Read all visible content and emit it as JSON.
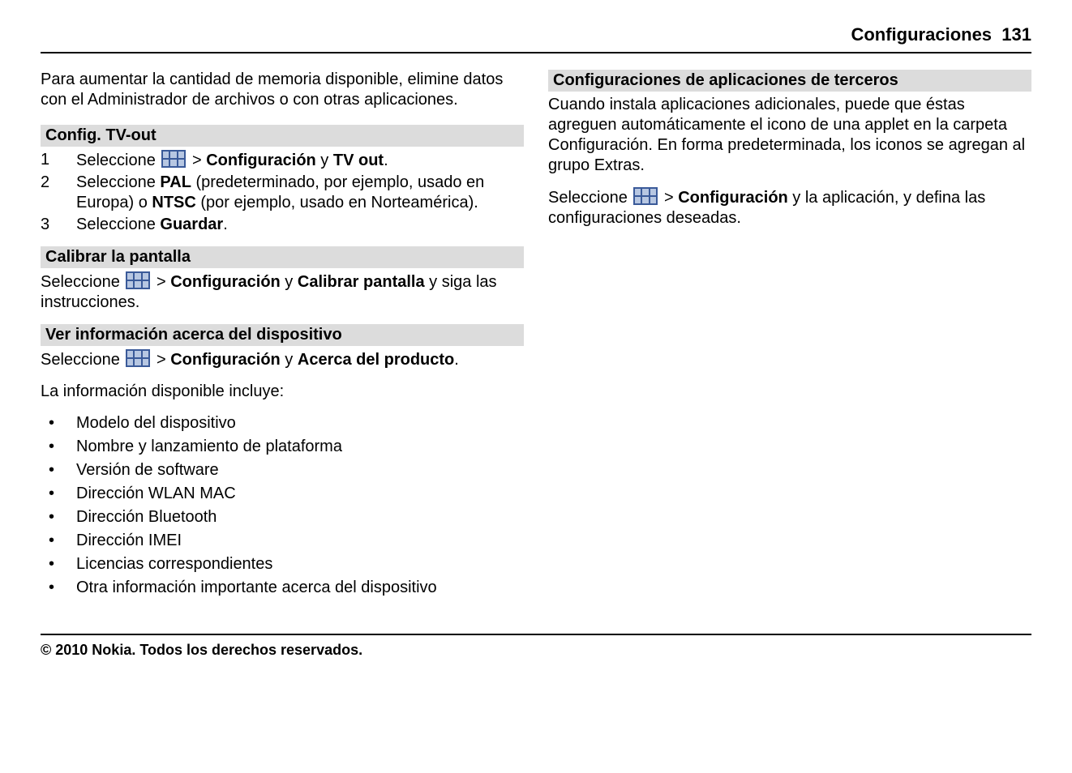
{
  "header": {
    "title": "Configuraciones",
    "page": "131"
  },
  "left": {
    "intro": "Para aumentar la cantidad de memoria disponible, elimine datos con el Administrador de archivos o con otras aplicaciones.",
    "tvout": {
      "title": "Config. TV-out",
      "steps": [
        {
          "num": "1",
          "pre": "Seleccione ",
          "gt": " > ",
          "b1": "Configuración",
          "mid": " y ",
          "b2": "TV out",
          "post": "."
        },
        {
          "num": "2",
          "pre": "Seleccione ",
          "b1": "PAL",
          "mid": " (predeterminado, por ejemplo, usado en Europa) o ",
          "b2": "NTSC",
          "post": " (por ejemplo, usado en Norteamérica)."
        },
        {
          "num": "3",
          "pre": "Seleccione ",
          "b1": "Guardar",
          "post": "."
        }
      ]
    },
    "calibrar": {
      "title": "Calibrar la pantalla",
      "pre": "Seleccione ",
      "gt": " > ",
      "b1": "Configuración",
      "mid": " y ",
      "b2": "Calibrar pantalla",
      "post": " y siga las instrucciones."
    },
    "verinfo": {
      "title": "Ver información acerca del dispositivo",
      "pre": "Seleccione ",
      "gt": " > ",
      "b1": "Configuración",
      "mid": " y ",
      "b2": "Acerca del producto",
      "post": ".",
      "intro2": "La información disponible incluye:",
      "items": [
        "Modelo del dispositivo",
        "Nombre y lanzamiento de plataforma",
        "Versión de software",
        "Dirección WLAN MAC",
        "Dirección Bluetooth",
        "Dirección IMEI",
        "Licencias correspondientes",
        "Otra información importante acerca del dispositivo"
      ]
    }
  },
  "right": {
    "terceros": {
      "title": "Configuraciones de aplicaciones de terceros",
      "para": "Cuando instala aplicaciones adicionales, puede que éstas agreguen automáticamente el icono de una applet en la carpeta Configuración. En forma predeterminada, los iconos se agregan al grupo Extras.",
      "pre": "Seleccione ",
      "gt": " > ",
      "b1": "Configuración",
      "post": " y la aplicación, y defina las configuraciones deseadas."
    }
  },
  "footer": "© 2010 Nokia. Todos los derechos reservados."
}
